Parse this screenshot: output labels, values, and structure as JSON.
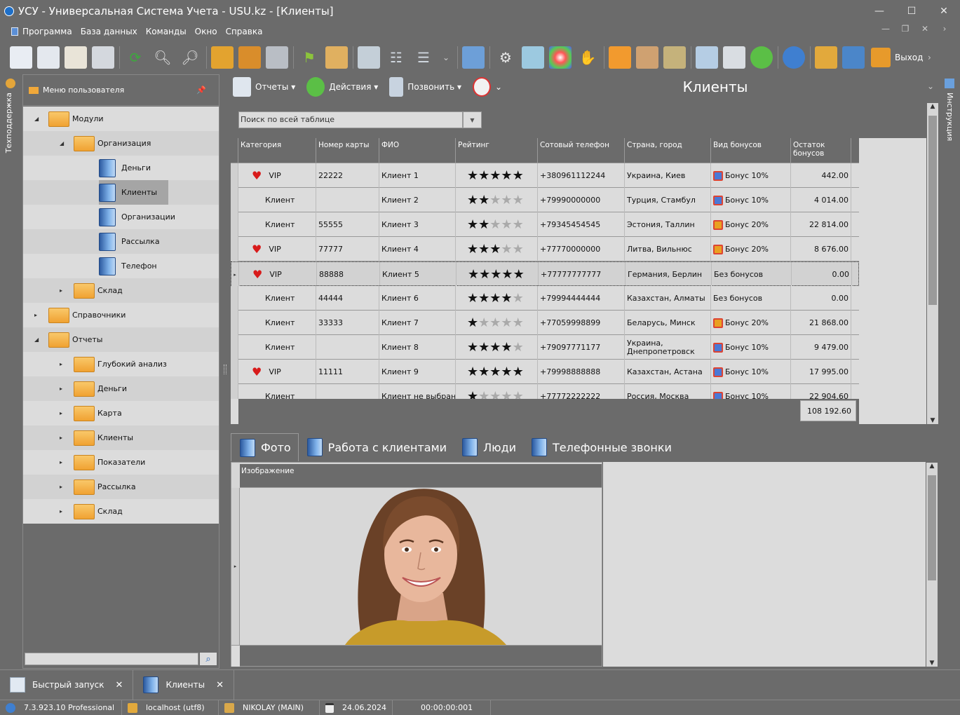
{
  "window": {
    "title": "УСУ - Универсальная Система Учета - USU.kz - [Клиенты]",
    "controls": [
      "—",
      "☐",
      "✕"
    ]
  },
  "menu": {
    "items": [
      "Программа",
      "База данных",
      "Команды",
      "Окно",
      "Справка"
    ],
    "mdi_controls": [
      "—",
      "❐",
      "✕",
      "›"
    ]
  },
  "toolbar": {
    "exit_label": "Выход"
  },
  "side_strips": {
    "left": "Техподдержка",
    "right": "Инструкция"
  },
  "sidebar": {
    "title": "Меню пользователя",
    "pin": "📌",
    "tree": [
      {
        "label": "Модули",
        "level": 0,
        "type": "folder",
        "exp": "◢"
      },
      {
        "label": "Организация",
        "level": 1,
        "type": "folder",
        "exp": "◢"
      },
      {
        "label": "Деньги",
        "level": 2,
        "type": "book"
      },
      {
        "label": "Клиенты",
        "level": 2,
        "type": "book",
        "selected": true
      },
      {
        "label": "Организации",
        "level": 2,
        "type": "book"
      },
      {
        "label": "Рассылка",
        "level": 2,
        "type": "book"
      },
      {
        "label": "Телефон",
        "level": 2,
        "type": "book"
      },
      {
        "label": "Склад",
        "level": 1,
        "type": "folder",
        "exp": "▸"
      },
      {
        "label": "Справочники",
        "level": 0,
        "type": "folder",
        "exp": "▸"
      },
      {
        "label": "Отчеты",
        "level": 0,
        "type": "folder",
        "exp": "◢"
      },
      {
        "label": "Глубокий анализ",
        "level": 1,
        "type": "folder",
        "exp": "▸"
      },
      {
        "label": "Деньги",
        "level": 1,
        "type": "folder",
        "exp": "▸"
      },
      {
        "label": "Карта",
        "level": 1,
        "type": "folder",
        "exp": "▸"
      },
      {
        "label": "Клиенты",
        "level": 1,
        "type": "folder",
        "exp": "▸"
      },
      {
        "label": "Показатели",
        "level": 1,
        "type": "folder",
        "exp": "▸"
      },
      {
        "label": "Рассылка",
        "level": 1,
        "type": "folder",
        "exp": "▸"
      },
      {
        "label": "Склад",
        "level": 1,
        "type": "folder",
        "exp": "▸"
      }
    ]
  },
  "content_toolbar": {
    "reports": "Отчеты ▾",
    "actions": "Действия ▾",
    "call": "Позвонить ▾",
    "more": "⌄"
  },
  "page_title": "Клиенты",
  "search": {
    "placeholder": "Поиск по всей таблице"
  },
  "table": {
    "columns": [
      {
        "label": "Категория",
        "w": 122
      },
      {
        "label": "Номер карты",
        "w": 90
      },
      {
        "label": "ФИО",
        "w": 109
      },
      {
        "label": "Рейтинг",
        "w": 117
      },
      {
        "label": "Сотовый телефон",
        "w": 124
      },
      {
        "label": "Страна, город",
        "w": 123
      },
      {
        "label": "Вид бонусов",
        "w": 114
      },
      {
        "label": "Остаток бонусов",
        "w": 86
      }
    ],
    "rows": [
      {
        "vip": true,
        "category": "VIP",
        "card": "22222",
        "name": "Клиент 1",
        "rating": 5,
        "phone": "+380961112244",
        "city": "Украина, Киев",
        "bonus_type": "Бонус 10%",
        "bonus_icon": "blue",
        "balance": "442.00"
      },
      {
        "vip": false,
        "category": "Клиент",
        "card": "",
        "name": "Клиент 2",
        "rating": 2,
        "phone": "+79990000000",
        "city": "Турция, Стамбул",
        "bonus_type": "Бонус 10%",
        "bonus_icon": "blue",
        "balance": "4 014.00"
      },
      {
        "vip": false,
        "category": "Клиент",
        "card": "55555",
        "name": "Клиент 3",
        "rating": 2,
        "phone": "+79345454545",
        "city": "Эстония, Таллин",
        "bonus_type": "Бонус 20%",
        "bonus_icon": "orange",
        "balance": "22 814.00"
      },
      {
        "vip": true,
        "category": "VIP",
        "card": "77777",
        "name": "Клиент 4",
        "rating": 3,
        "phone": "+77770000000",
        "city": "Литва, Вильнюс",
        "bonus_type": "Бонус 20%",
        "bonus_icon": "orange",
        "balance": "8 676.00"
      },
      {
        "vip": true,
        "category": "VIP",
        "card": "88888",
        "name": "Клиент 5",
        "rating": 5,
        "phone": "+77777777777",
        "city": "Германия, Берлин",
        "bonus_type": "Без бонусов",
        "bonus_icon": "",
        "balance": "0.00",
        "current": true
      },
      {
        "vip": false,
        "category": "Клиент",
        "card": "44444",
        "name": "Клиент 6",
        "rating": 4,
        "phone": "+79994444444",
        "city": "Казахстан, Алматы",
        "bonus_type": "Без бонусов",
        "bonus_icon": "",
        "balance": "0.00"
      },
      {
        "vip": false,
        "category": "Клиент",
        "card": "33333",
        "name": "Клиент 7",
        "rating": 1,
        "phone": "+77059998899",
        "city": "Беларусь, Минск",
        "bonus_type": "Бонус 20%",
        "bonus_icon": "orange",
        "balance": "21 868.00"
      },
      {
        "vip": false,
        "category": "Клиент",
        "card": "",
        "name": "Клиент 8",
        "rating": 4,
        "phone": "+79097771177",
        "city": "Украина, Днепропетровск",
        "bonus_type": "Бонус 10%",
        "bonus_icon": "blue",
        "balance": "9 479.00"
      },
      {
        "vip": true,
        "category": "VIP",
        "card": "11111",
        "name": "Клиент 9",
        "rating": 5,
        "phone": "+79998888888",
        "city": "Казахстан, Астана",
        "bonus_type": "Бонус 10%",
        "bonus_icon": "blue",
        "balance": "17 995.00"
      },
      {
        "vip": false,
        "category": "Клиент",
        "card": "",
        "name": "Клиент не выбран",
        "rating": 1,
        "phone": "+77772222222",
        "city": "Россия, Москва",
        "bonus_type": "Бонус 10%",
        "bonus_icon": "blue",
        "balance": "22 904.60"
      }
    ],
    "total": "108 192.60"
  },
  "tabs": [
    "Фото",
    "Работа с клиентами",
    "Люди",
    "Телефонные звонки"
  ],
  "detail": {
    "column": "Изображение"
  },
  "window_tabs": [
    {
      "label": "Быстрый запуск",
      "close": "✕"
    },
    {
      "label": "Клиенты",
      "close": "✕"
    }
  ],
  "status": {
    "version": "7.3.923.10 Professional",
    "db": "localhost (utf8)",
    "user": "NIKOLAY (MAIN)",
    "date": "24.06.2024",
    "timer": "00:00:00:001"
  },
  "colors": {
    "bg": "#6b6b6b",
    "grid": "#dcdcdc",
    "heart": "#d81b1b",
    "folder": "#f0a232",
    "accent": "#1e6fc8"
  }
}
